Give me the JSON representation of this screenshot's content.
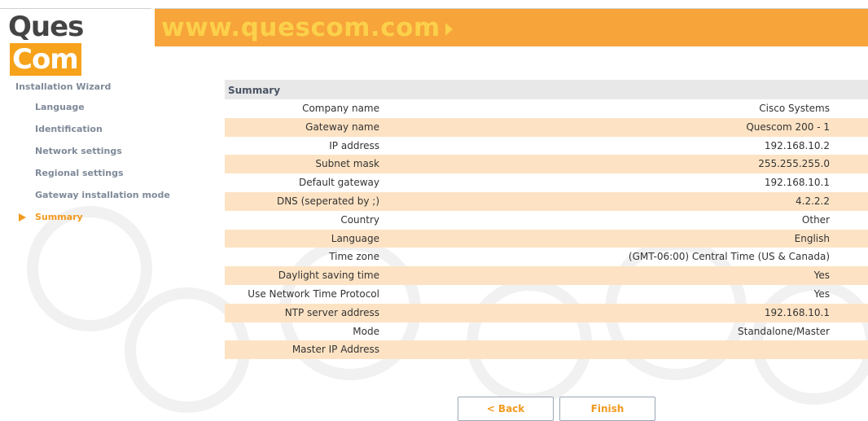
{
  "header": {
    "logo_left": "Ques",
    "logo_right": "Com",
    "banner_url": "www.quescom.com",
    "colors": {
      "orange": "#f7a43a",
      "url_yellow": "#fbd04a",
      "logo_dark": "#444444"
    }
  },
  "sidebar": {
    "title": "Installation Wizard",
    "items": [
      {
        "label": "Language"
      },
      {
        "label": "Identification"
      },
      {
        "label": "Network settings"
      },
      {
        "label": "Regional settings"
      },
      {
        "label": "Gateway installation mode"
      },
      {
        "label": "Summary",
        "active": true
      }
    ],
    "active_icon": "play-arrow-icon"
  },
  "summary": {
    "title": "Summary",
    "rows": [
      {
        "label": "Company name",
        "value": "Cisco Systems"
      },
      {
        "label": "Gateway name",
        "value": "Quescom 200 - 1"
      },
      {
        "label": "IP address",
        "value": "192.168.10.2"
      },
      {
        "label": "Subnet mask",
        "value": "255.255.255.0"
      },
      {
        "label": "Default gateway",
        "value": "192.168.10.1"
      },
      {
        "label": "DNS (seperated by ;)",
        "value": "4.2.2.2"
      },
      {
        "label": "Country",
        "value": "Other"
      },
      {
        "label": "Language",
        "value": "English"
      },
      {
        "label": "Time zone",
        "value": "(GMT-06:00) Central Time (US & Canada)"
      },
      {
        "label": "Daylight saving time",
        "value": "Yes"
      },
      {
        "label": "Use Network Time Protocol",
        "value": "Yes"
      },
      {
        "label": "NTP server address",
        "value": "192.168.10.1"
      },
      {
        "label": "Mode",
        "value": "Standalone/Master"
      },
      {
        "label": "Master IP Address",
        "value": ""
      }
    ],
    "colors": {
      "header_bg": "#e8e8e8",
      "alt_row_bg": "#fde3c4"
    }
  },
  "buttons": {
    "back": "<  Back",
    "finish": "Finish"
  }
}
